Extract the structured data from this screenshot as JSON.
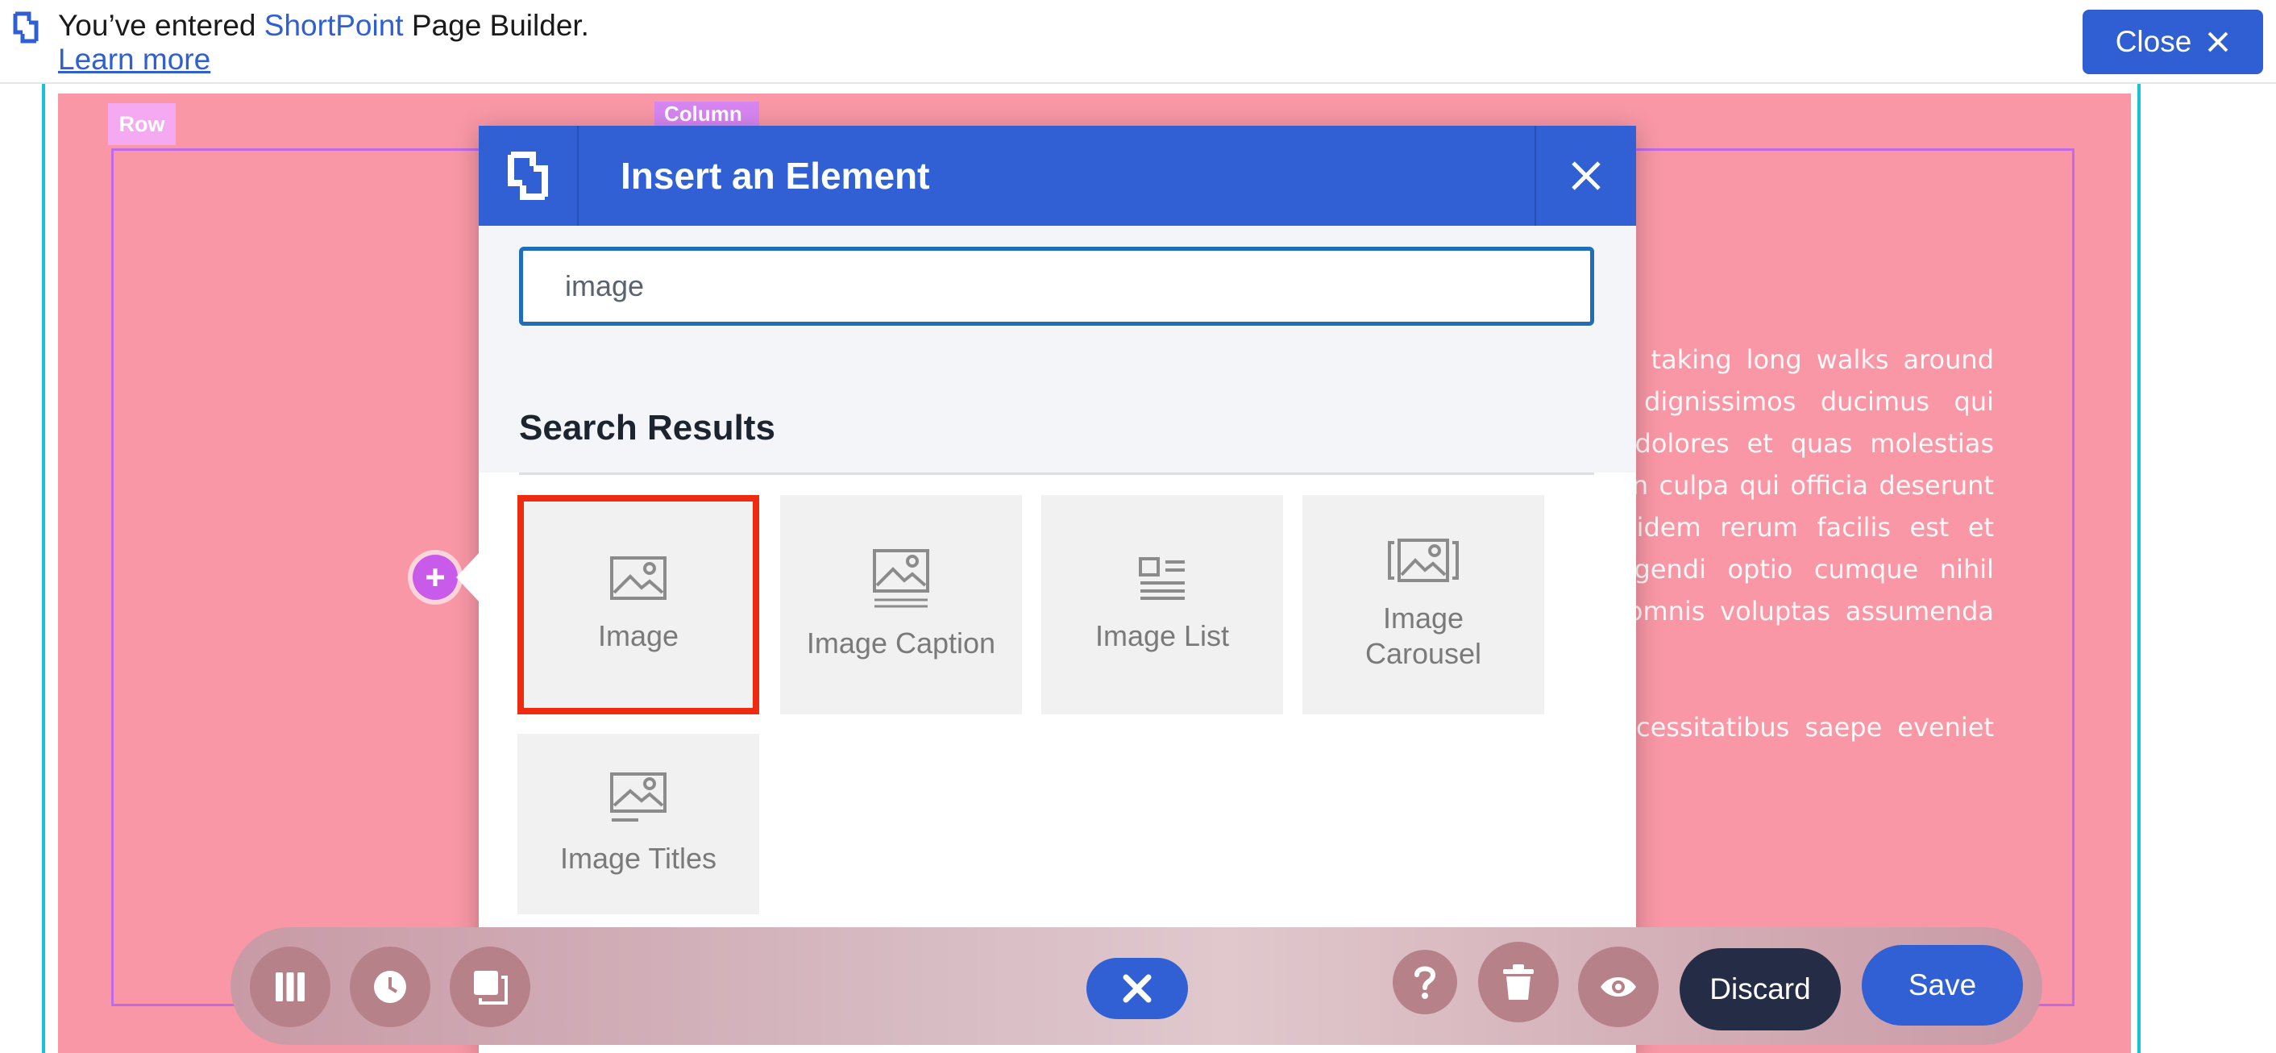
{
  "notice": {
    "prefix": "You’ve entered ",
    "brand": "ShortPoint",
    "suffix": " Page Builder.",
    "learn_more": "Learn more",
    "close_label": "Close"
  },
  "canvas": {
    "row_tag": "Row",
    "column_tag": "Column",
    "text_lines": [
      "nd taking long walks around",
      "o dignissimos ducimus qui",
      "s dolores et quas molestias",
      "t in culpa qui officia deserunt",
      "quidem rerum facilis est et",
      "eligendi optio cumque nihil",
      ". omnis voluptas assumenda",
      "necessitatibus saepe eveniet"
    ]
  },
  "dialog": {
    "title": "Insert an Element",
    "search_value": "image",
    "results_title": "Search Results",
    "results": [
      {
        "label": "Image",
        "icon": "image-icon",
        "selected": true
      },
      {
        "label": "Image Caption",
        "icon": "image-caption-icon",
        "selected": false
      },
      {
        "label": "Image List",
        "icon": "image-list-icon",
        "selected": false
      },
      {
        "label": "Image\nCarousel",
        "icon": "image-carousel-icon",
        "selected": false
      },
      {
        "label": "Image Titles",
        "icon": "image-titles-icon",
        "selected": false
      }
    ]
  },
  "toolbar": {
    "discard_label": "Discard",
    "save_label": "Save"
  },
  "colors": {
    "accent": "#3060d3",
    "canvas_pink": "#f997a6",
    "selection_red": "#ee2a10",
    "guide_cyan": "#19c3d6",
    "outline_purple": "#c06ae8"
  }
}
